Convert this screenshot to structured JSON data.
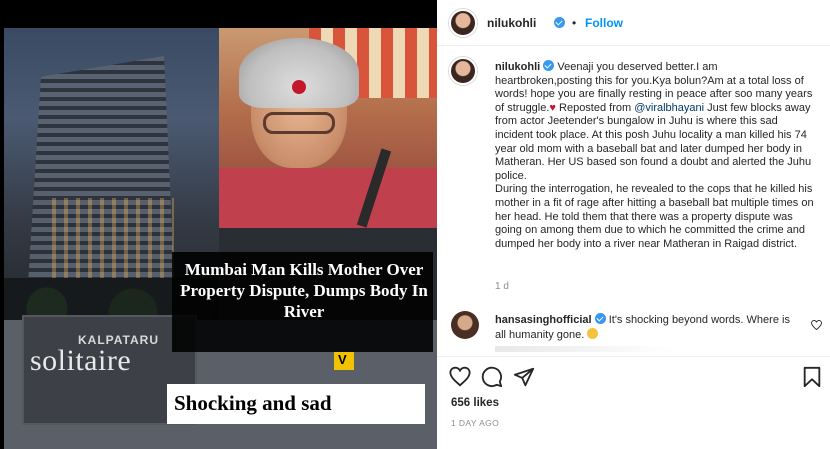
{
  "post_image": {
    "sign_small": "KALPATARU",
    "sign_big": "solitaire",
    "headline": "Mumbai Man Kills Mother Over Property Dispute, Dumps Body In River",
    "logo_letter": "V",
    "tagline": "Shocking and sad"
  },
  "header": {
    "username": "nilukohli",
    "separator": "•",
    "follow_label": "Follow",
    "more_label": "•••"
  },
  "caption": {
    "username": "nilukohli",
    "text_part1": "Veenaji you deserved better.I am heartbroken,posting this for you.Kya bolun?Am at a total loss of words! hope you are finally resting in peace after soo many years of struggle.",
    "heart": "♥",
    "repost_prefix": " Reposted from ",
    "mention": "@viralbhayani",
    "text_part2": " Just few blocks away from actor Jeetender's bungalow in Juhu is where this sad incident took place. At this posh Juhu locality a man killed his 74 year old mom with a baseball bat and later dumped her body in Matheran. Her US based son found a doubt and alerted the Juhu police.",
    "text_part3": "During the interrogation, he revealed to the cops that he killed his mother in a fit of rage after hitting a baseball bat multiple times on her head. He told them that there was a property dispute was going on among them due to which he committed the crime and dumped her body into a river near Matheran in Raigad district.",
    "age": "1 d"
  },
  "comment": {
    "username": "hansasinghofficial",
    "text": "It's shocking beyond words. Where is all humanity gone."
  },
  "actions": {
    "likes": "656 likes",
    "date": "1 DAY AGO"
  },
  "colors": {
    "accent": "#0095f6",
    "verified": "#3897f0",
    "muted": "#8e8e8e"
  },
  "icons": [
    "heart-icon",
    "comment-icon",
    "share-icon",
    "bookmark-icon",
    "verified-icon",
    "more-icon"
  ]
}
